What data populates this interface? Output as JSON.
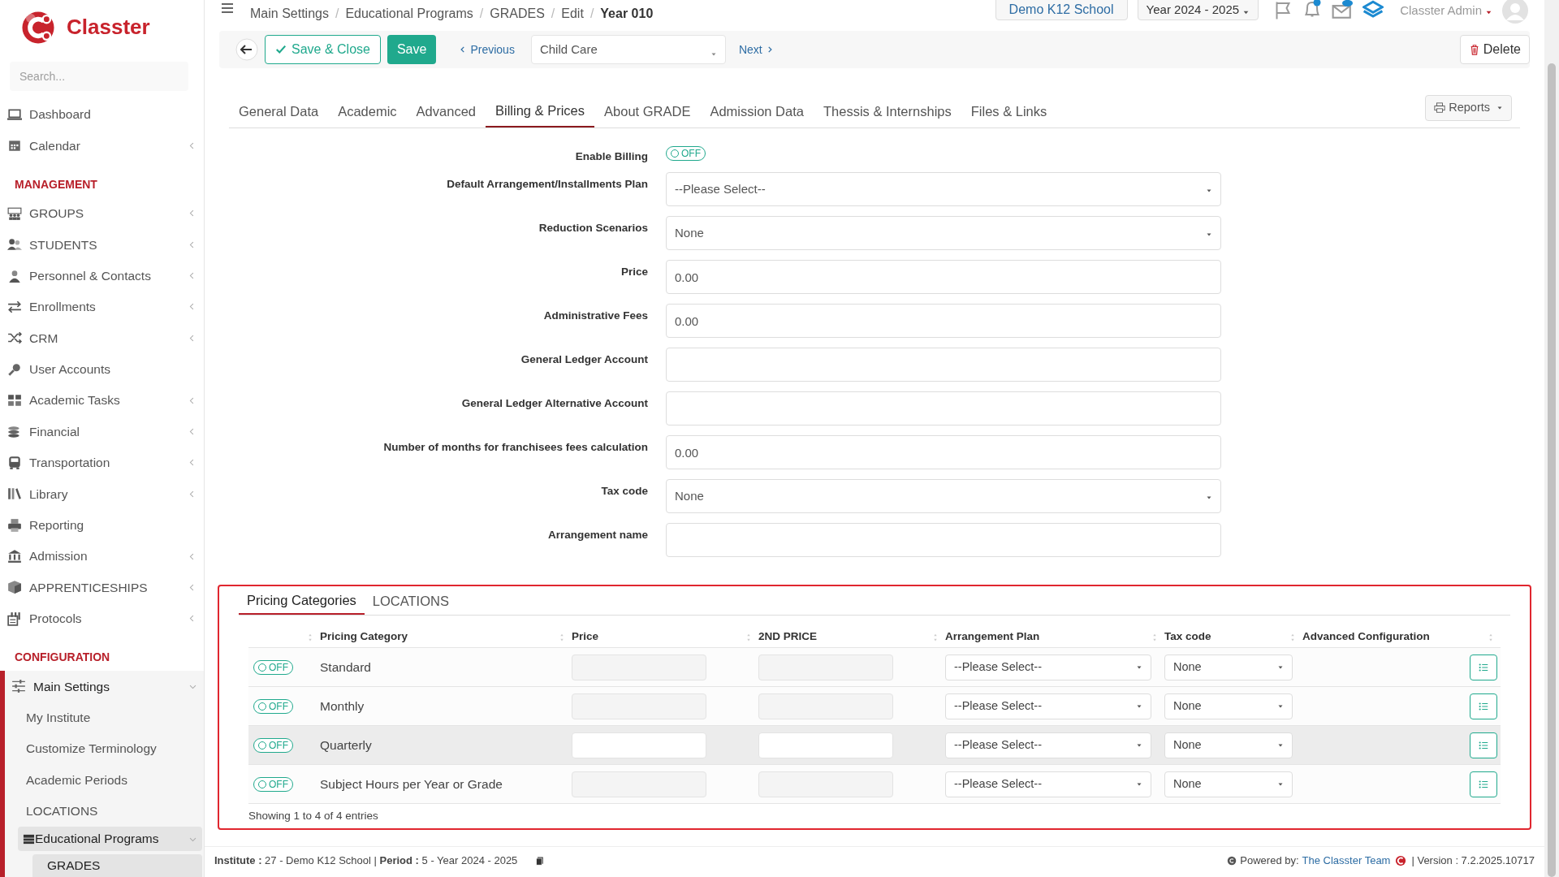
{
  "brand": {
    "name": "Classter"
  },
  "sidebar": {
    "search": {
      "placeholder": "Search..."
    },
    "items": [
      {
        "kind": "item",
        "label": "Dashboard",
        "has_submenu": false
      },
      {
        "kind": "item",
        "label": "Calendar",
        "has_submenu": true
      },
      {
        "kind": "heading",
        "label": "MANAGEMENT"
      },
      {
        "kind": "item",
        "label": "GROUPS",
        "has_submenu": true
      },
      {
        "kind": "item",
        "label": "STUDENTS",
        "has_submenu": true
      },
      {
        "kind": "item",
        "label": "Personnel & Contacts",
        "has_submenu": true
      },
      {
        "kind": "item",
        "label": "Enrollments",
        "has_submenu": true
      },
      {
        "kind": "item",
        "label": "CRM",
        "has_submenu": true
      },
      {
        "kind": "item",
        "label": "User Accounts",
        "has_submenu": false
      },
      {
        "kind": "item",
        "label": "Academic Tasks",
        "has_submenu": true
      },
      {
        "kind": "item",
        "label": "Financial",
        "has_submenu": true
      },
      {
        "kind": "item",
        "label": "Transportation",
        "has_submenu": true
      },
      {
        "kind": "item",
        "label": "Library",
        "has_submenu": true
      },
      {
        "kind": "item",
        "label": "Reporting",
        "has_submenu": false
      },
      {
        "kind": "item",
        "label": "Admission",
        "has_submenu": true
      },
      {
        "kind": "item",
        "label": "APPRENTICESHIPS",
        "has_submenu": true
      },
      {
        "kind": "item",
        "label": "Protocols",
        "has_submenu": true
      },
      {
        "kind": "heading",
        "label": "CONFIGURATION"
      },
      {
        "kind": "item",
        "label": "Main Settings",
        "has_submenu": true,
        "expanded": true,
        "children": [
          {
            "label": "My Institute",
            "selected": false
          },
          {
            "label": "Customize Terminology",
            "selected": false
          },
          {
            "label": "Academic Periods",
            "selected": false
          },
          {
            "label": "LOCATIONS",
            "selected": false
          },
          {
            "label": "Educational Programs",
            "selected": true,
            "expanded": true,
            "children": [
              {
                "label": "GRADES",
                "selected": true
              }
            ]
          }
        ]
      }
    ]
  },
  "breadcrumb": {
    "separator": "/",
    "items": [
      "Main Settings",
      "Educational Programs",
      "GRADES",
      "Edit",
      "Year 010"
    ]
  },
  "header": {
    "school": "Demo K12 School",
    "year": "Year 2024 - 2025",
    "user": "Classter Admin"
  },
  "toolbar": {
    "save_close": "Save & Close",
    "save": "Save",
    "previous": "Previous",
    "record": "Child Care",
    "next": "Next",
    "delete": "Delete"
  },
  "tabs": [
    {
      "label": "General Data",
      "selected": false
    },
    {
      "label": "Academic",
      "selected": false
    },
    {
      "label": "Advanced",
      "selected": false
    },
    {
      "label": "Billing & Prices",
      "selected": true
    },
    {
      "label": "About GRADE",
      "selected": false
    },
    {
      "label": "Admission Data",
      "selected": false
    },
    {
      "label": "Thessis & Internships",
      "selected": false
    },
    {
      "label": "Files & Links",
      "selected": false
    }
  ],
  "reports": "Reports",
  "form": [
    {
      "kind": "toggle",
      "label": "Enable Billing",
      "value": "OFF",
      "on": false
    },
    {
      "kind": "select",
      "label": "Default Arrangement/Installments Plan",
      "value": "--Please Select--"
    },
    {
      "kind": "select",
      "label": "Reduction Scenarios",
      "value": "None"
    },
    {
      "kind": "input",
      "label": "Price",
      "value": "0.00"
    },
    {
      "kind": "input",
      "label": "Administrative Fees",
      "value": "0.00"
    },
    {
      "kind": "input",
      "label": "General Ledger Account"
    },
    {
      "kind": "input",
      "label": "General Ledger Alternative Account"
    },
    {
      "kind": "input",
      "label": "Number of months for franchisees fees calculation",
      "value": "0.00"
    },
    {
      "kind": "select",
      "label": "Tax code",
      "value": "None"
    },
    {
      "kind": "input",
      "label": "Arrangement name"
    }
  ],
  "pricing": {
    "tabs": [
      {
        "label": "Pricing Categories",
        "selected": true
      },
      {
        "label": "LOCATIONS",
        "selected": false
      }
    ],
    "columns": [
      "Pricing Category",
      "Price",
      "2ND PRICE",
      "Arrangement Plan",
      "Tax code",
      "Advanced Configuration"
    ],
    "rows": [
      {
        "toggle": "OFF",
        "on": false,
        "category": "Standard",
        "arrangement": "--Please Select--",
        "tax_code": "None",
        "highlighted": false
      },
      {
        "toggle": "OFF",
        "on": false,
        "category": "Monthly",
        "arrangement": "--Please Select--",
        "tax_code": "None",
        "highlighted": false
      },
      {
        "toggle": "OFF",
        "on": false,
        "category": "Quarterly",
        "arrangement": "--Please Select--",
        "tax_code": "None",
        "highlighted": true
      },
      {
        "toggle": "OFF",
        "on": false,
        "category": "Subject Hours per Year or Grade",
        "arrangement": "--Please Select--",
        "tax_code": "None",
        "highlighted": false
      }
    ],
    "info": "Showing 1 to 4 of 4 entries"
  },
  "footer": {
    "info": "**Institute :** 27 - Demo K12 School | **Period :** 5 - Year 2024 - 2025",
    "powered": "Powered by:",
    "team": "The Classter Team",
    "version": "| Version : 7.2.2025.10717"
  }
}
